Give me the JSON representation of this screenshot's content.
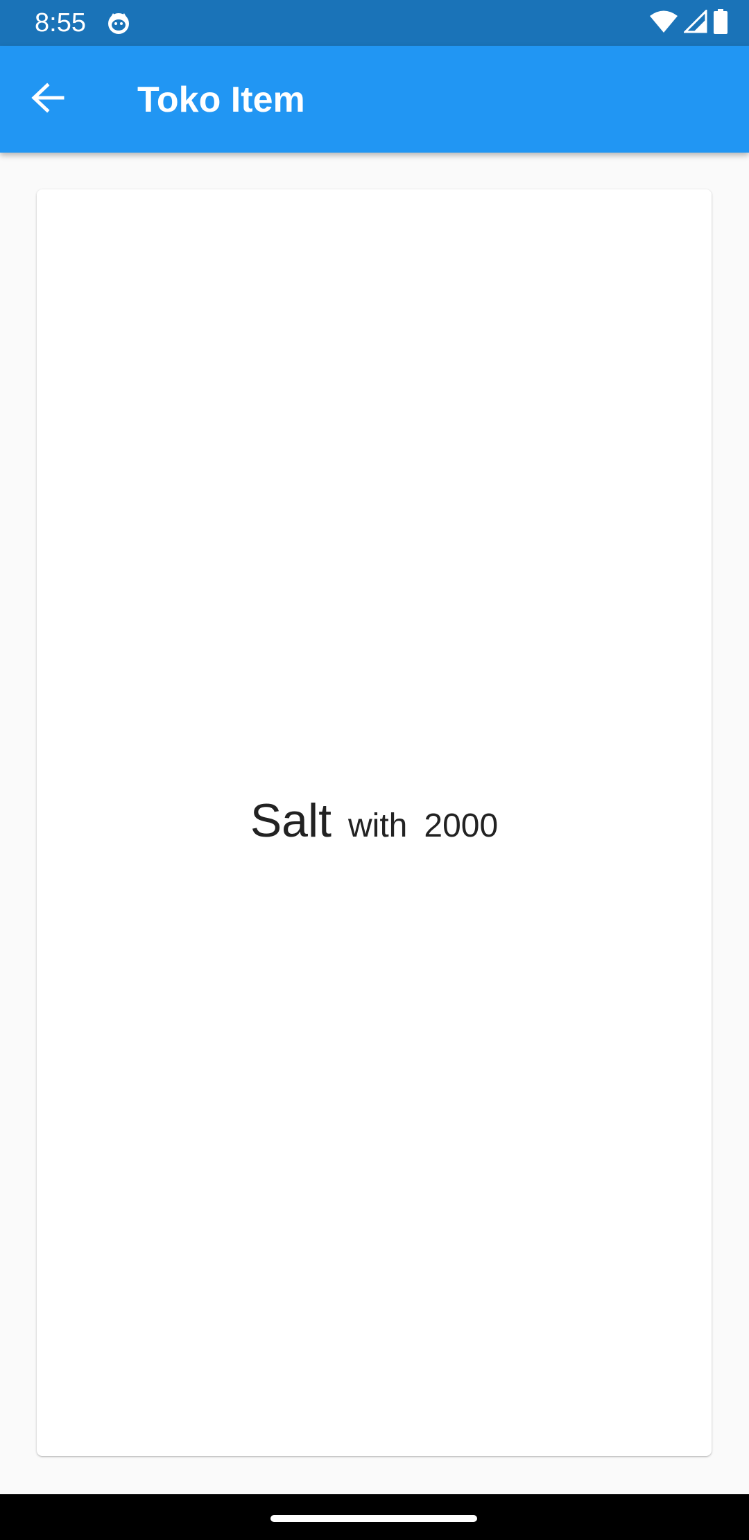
{
  "status_bar": {
    "time": "8:55",
    "app_icon": "cat-face-icon",
    "icons": [
      "wifi-icon",
      "signal-icon",
      "battery-icon"
    ]
  },
  "app_bar": {
    "back_icon": "arrow-back-icon",
    "title": "Toko Item",
    "color": "#2196f3"
  },
  "item": {
    "name": "Salt",
    "connector": "with",
    "price": "2000"
  },
  "nav_bar": {
    "handle": "home-gesture-handle"
  }
}
